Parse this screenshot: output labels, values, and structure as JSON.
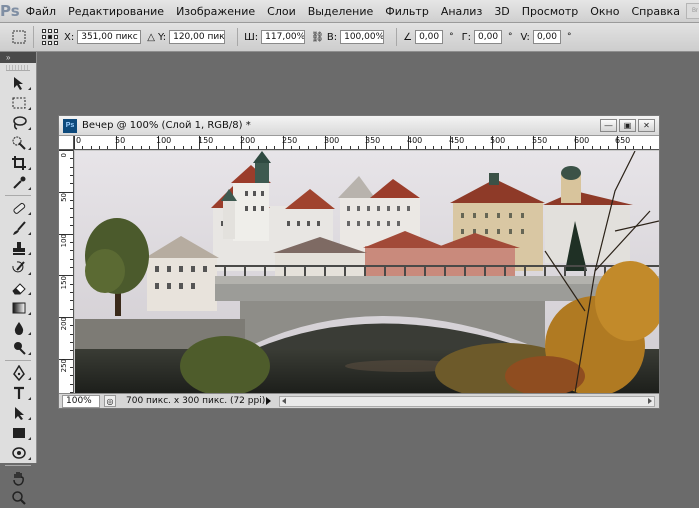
{
  "app": {
    "logo": "Ps"
  },
  "menu": [
    "Файл",
    "Редактирование",
    "Изображение",
    "Слои",
    "Выделение",
    "Фильтр",
    "Анализ",
    "3D",
    "Просмотр",
    "Окно",
    "Справка"
  ],
  "menu_right": [
    "Br",
    "Mb"
  ],
  "options": {
    "x_label": "X:",
    "x_value": "351,00 пикс",
    "y_label": "Y:",
    "y_value": "120,00 пикс",
    "w_label": "Ш:",
    "w_value": "117,00%",
    "h_label": "В:",
    "h_value": "100,00%",
    "angle_value": "0,00",
    "angle_unit": "°",
    "hskew_label": "Г:",
    "hskew_value": "0,00",
    "hskew_unit": "°",
    "vskew_label": "V:",
    "vskew_value": "0,00",
    "vskew_unit": "°"
  },
  "document": {
    "icon": "Ps",
    "title": "Вечер @ 100% (Слой 1, RGB/8) *",
    "zoom": "100%",
    "info": "700 пикс. x 300 пикс. (72 ppi)",
    "ruler_h": [
      "0",
      "50",
      "100",
      "150",
      "200",
      "250",
      "300",
      "350",
      "400",
      "450",
      "500",
      "550",
      "600",
      "650"
    ],
    "ruler_v": [
      "0",
      "50",
      "100",
      "150",
      "200",
      "250"
    ]
  },
  "colors": {
    "accent": "#0e4a7c",
    "workspace": "#6b6b6b"
  }
}
